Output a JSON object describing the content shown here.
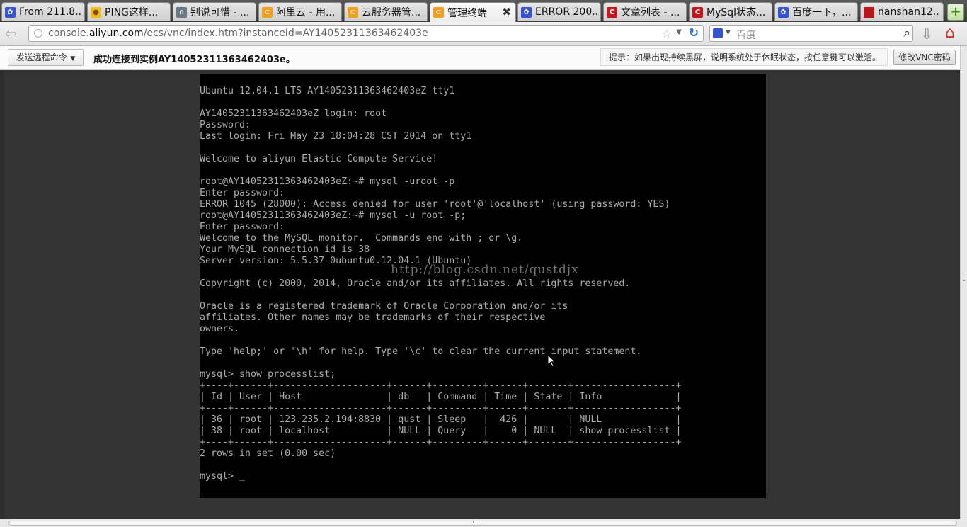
{
  "browser": {
    "tabs": [
      {
        "label": "From 211.8...",
        "icon": "baidu-paw-icon",
        "active": false
      },
      {
        "label": "PING这样...",
        "icon": "zhidao-bulb-icon",
        "active": false
      },
      {
        "label": "别说可惜 - ...",
        "icon": "headphones-icon",
        "active": false
      },
      {
        "label": "阿里云 - 用...",
        "icon": "aliyun-icon",
        "active": false
      },
      {
        "label": "云服务器管...",
        "icon": "aliyun-icon",
        "active": false
      },
      {
        "label": "管理终端",
        "icon": "aliyun-icon",
        "active": true
      },
      {
        "label": "ERROR 200...",
        "icon": "baidu-paw-icon",
        "active": false
      },
      {
        "label": "文章列表 - ...",
        "icon": "csdn-icon",
        "active": false
      },
      {
        "label": "MySql状态...",
        "icon": "csdn-icon",
        "active": false
      },
      {
        "label": "百度一下，...",
        "icon": "baidu-paw-icon",
        "active": false
      },
      {
        "label": "nanshan12...",
        "icon": "bookmark-red-icon",
        "active": false
      }
    ],
    "new_tab_label": "+",
    "address": {
      "prefix": "console.",
      "host": "aliyun.com",
      "path": "/ecs/vnc/index.htm?instanceId=AY14052311363462403e"
    },
    "search_placeholder": "百度"
  },
  "vnc_toolbar": {
    "send_command_label": "发送远程命令",
    "status_message": "成功连接到实例AY14052311363462403e。",
    "hint": "提示：如果出现持续黑屏，说明系统处于休眠状态，按任意键可以激活。",
    "change_password_label": "修改VNC密码"
  },
  "console": {
    "lines": [
      "Ubuntu 12.04.1 LTS AY14052311363462403eZ tty1",
      "",
      "AY14052311363462403eZ login: root",
      "Password:",
      "Last login: Fri May 23 18:04:28 CST 2014 on tty1",
      "",
      "Welcome to aliyun Elastic Compute Service!",
      "",
      "root@AY14052311363462403eZ:~# mysql -uroot -p",
      "Enter password:",
      "ERROR 1045 (28000): Access denied for user 'root'@'localhost' (using password: YES)",
      "root@AY14052311363462403eZ:~# mysql -u root -p;",
      "Enter password:",
      "Welcome to the MySQL monitor.  Commands end with ; or \\g.",
      "Your MySQL connection id is 38",
      "Server version: 5.5.37-0ubuntu0.12.04.1 (Ubuntu)",
      "",
      "Copyright (c) 2000, 2014, Oracle and/or its affiliates. All rights reserved.",
      "",
      "Oracle is a registered trademark of Oracle Corporation and/or its",
      "affiliates. Other names may be trademarks of their respective",
      "owners.",
      "",
      "Type 'help;' or '\\h' for help. Type '\\c' to clear the current input statement.",
      "",
      "mysql> show processlist;",
      "+----+------+--------------------+------+---------+------+-------+------------------+",
      "| Id | User | Host               | db   | Command | Time | State | Info             |",
      "+----+------+--------------------+------+---------+------+-------+------------------+",
      "| 36 | root | 123.235.2.194:8830 | qust | Sleep   |  426 |       | NULL             |",
      "| 38 | root | localhost          | NULL | Query   |    0 | NULL  | show processlist |",
      "+----+------+--------------------+------+---------+------+-------+------------------+",
      "2 rows in set (0.00 sec)",
      "",
      "mysql> _"
    ],
    "watermark": "http://blog.csdn.net/qustdjx"
  }
}
